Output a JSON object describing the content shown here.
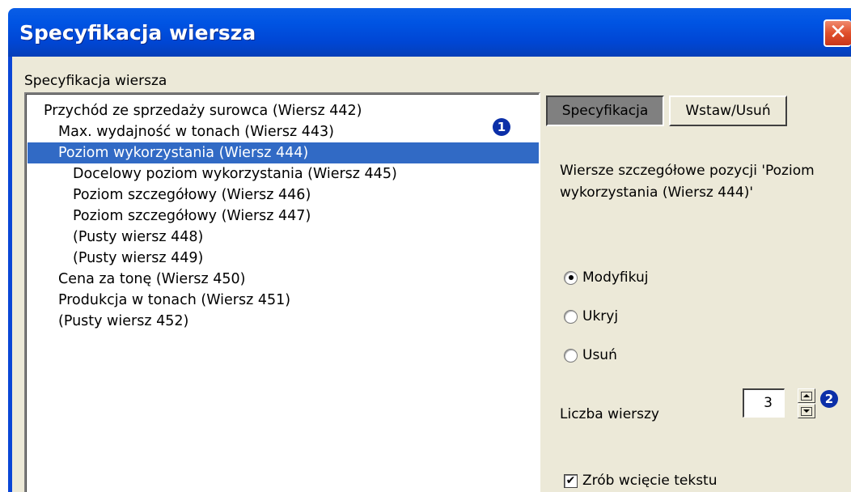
{
  "window": {
    "title": "Specyfikacja wiersza",
    "close_glyph": "✕"
  },
  "group": {
    "label": "Specyfikacja wiersza"
  },
  "list": {
    "items": [
      {
        "label": "Przychód ze sprzedaży surowca (Wiersz 442)",
        "indent": 0,
        "selected": false
      },
      {
        "label": "Max. wydajność w tonach (Wiersz 443)",
        "indent": 1,
        "selected": false
      },
      {
        "label": "Poziom wykorzystania (Wiersz 444)",
        "indent": 1,
        "selected": true
      },
      {
        "label": "Docelowy poziom wykorzystania (Wiersz 445)",
        "indent": 2,
        "selected": false
      },
      {
        "label": "Poziom szczegółowy (Wiersz 446)",
        "indent": 2,
        "selected": false
      },
      {
        "label": "Poziom szczegółowy (Wiersz 447)",
        "indent": 2,
        "selected": false
      },
      {
        "label": "(Pusty wiersz 448)",
        "indent": 2,
        "selected": false
      },
      {
        "label": "(Pusty wiersz 449)",
        "indent": 2,
        "selected": false
      },
      {
        "label": "Cena za tonę (Wiersz 450)",
        "indent": 1,
        "selected": false
      },
      {
        "label": "Produkcja w tonach (Wiersz 451)",
        "indent": 1,
        "selected": false
      },
      {
        "label": "(Pusty wiersz 452)",
        "indent": 1,
        "selected": false
      }
    ]
  },
  "badges": {
    "one": "1",
    "two": "2"
  },
  "tabs": {
    "spec": "Specyfikacja",
    "wstaw": "Wstaw/Usuń"
  },
  "description": "Wiersze szczegółowe pozycji 'Poziom wykorzystania (Wiersz 444)'",
  "radios": [
    {
      "label": "Modyfikuj",
      "checked": true
    },
    {
      "label": "Ukryj",
      "checked": false
    },
    {
      "label": "Usuń",
      "checked": false
    }
  ],
  "count": {
    "label": "Liczba wierszy",
    "value": "3"
  },
  "checkbox": {
    "label": "Zrób wcięcie tekstu",
    "checked": true,
    "glyph": "✔"
  },
  "colors": {
    "titlebar": "#0054e3",
    "selection": "#316ac5",
    "dialog_bg": "#ece9d8",
    "badge": "#0b2fa8",
    "close": "#e0502c"
  }
}
